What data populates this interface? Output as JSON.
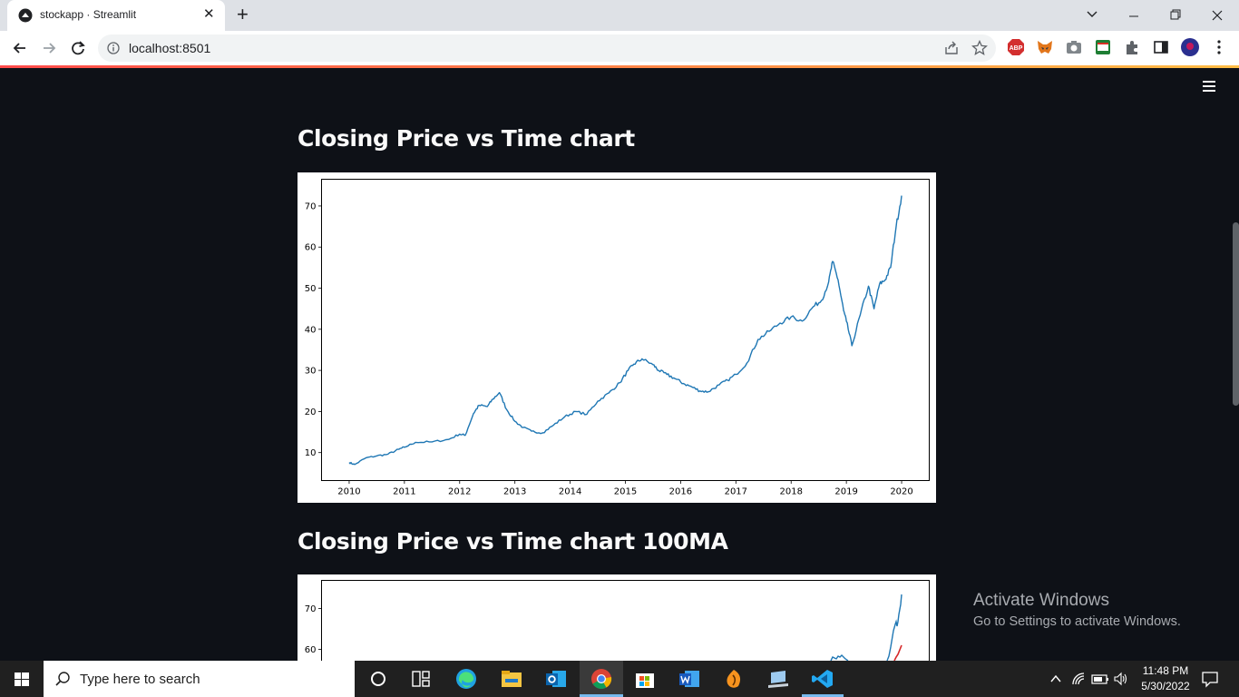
{
  "browser": {
    "tab_title": "stockapp · Streamlit",
    "url": "localhost:8501",
    "ext_badge": "ABP"
  },
  "app": {
    "sections": [
      {
        "title": "Closing Price vs Time chart"
      },
      {
        "title": "Closing Price vs Time chart 100MA"
      }
    ]
  },
  "chart_data": [
    {
      "type": "line",
      "title": "",
      "xlabel": "",
      "ylabel": "",
      "x_ticks": [
        "2010",
        "2011",
        "2012",
        "2013",
        "2014",
        "2015",
        "2016",
        "2017",
        "2018",
        "2019",
        "2020"
      ],
      "y_ticks": [
        "10",
        "20",
        "30",
        "40",
        "50",
        "60",
        "70"
      ],
      "xlim": [
        2009.5,
        2020.5
      ],
      "ylim": [
        3.2,
        76.5
      ],
      "grid": false,
      "series": [
        {
          "color": "#1f77b4",
          "x": [
            2010.0,
            2010.1,
            2010.3,
            2010.5,
            2010.7,
            2010.9,
            2011.0,
            2011.2,
            2011.5,
            2011.8,
            2012.0,
            2012.1,
            2012.25,
            2012.35,
            2012.5,
            2012.6,
            2012.72,
            2012.85,
            2013.0,
            2013.15,
            2013.3,
            2013.5,
            2013.7,
            2013.9,
            2014.1,
            2014.3,
            2014.5,
            2014.7,
            2014.9,
            2015.05,
            2015.15,
            2015.3,
            2015.5,
            2015.6,
            2015.75,
            2015.9,
            2016.05,
            2016.2,
            2016.35,
            2016.5,
            2016.7,
            2016.85,
            2017.0,
            2017.2,
            2017.4,
            2017.6,
            2017.8,
            2018.0,
            2018.2,
            2018.4,
            2018.55,
            2018.68,
            2018.75,
            2018.85,
            2018.95,
            2019.0,
            2019.1,
            2019.25,
            2019.4,
            2019.5,
            2019.6,
            2019.7,
            2019.8,
            2019.9,
            2020.0
          ],
          "y": [
            7.6,
            7.1,
            8.7,
            9.2,
            9.6,
            10.8,
            11.3,
            12.5,
            12.6,
            13.2,
            14.5,
            14.2,
            19.5,
            21.5,
            21.2,
            23.0,
            24.6,
            20.5,
            17.6,
            16.1,
            15.2,
            14.8,
            16.7,
            18.7,
            20.0,
            19.3,
            22.5,
            24.5,
            27.0,
            30.0,
            31.5,
            32.8,
            31.4,
            30.0,
            29.0,
            28.0,
            26.8,
            26.0,
            25.0,
            24.8,
            26.5,
            27.6,
            29.0,
            31.8,
            37.5,
            39.5,
            41.5,
            43.0,
            42.0,
            45.5,
            47.0,
            51.5,
            56.5,
            52.0,
            44.5,
            42.0,
            36.0,
            43.5,
            50.5,
            45.0,
            51.0,
            52.0,
            55.0,
            65.0,
            72.5
          ]
        }
      ]
    },
    {
      "type": "line",
      "title": "",
      "xlabel": "",
      "ylabel": "",
      "y_ticks": [
        "60",
        "70"
      ],
      "series": [
        {
          "color": "#1f77b4"
        },
        {
          "color": "#d62728"
        }
      ]
    }
  ]
}
